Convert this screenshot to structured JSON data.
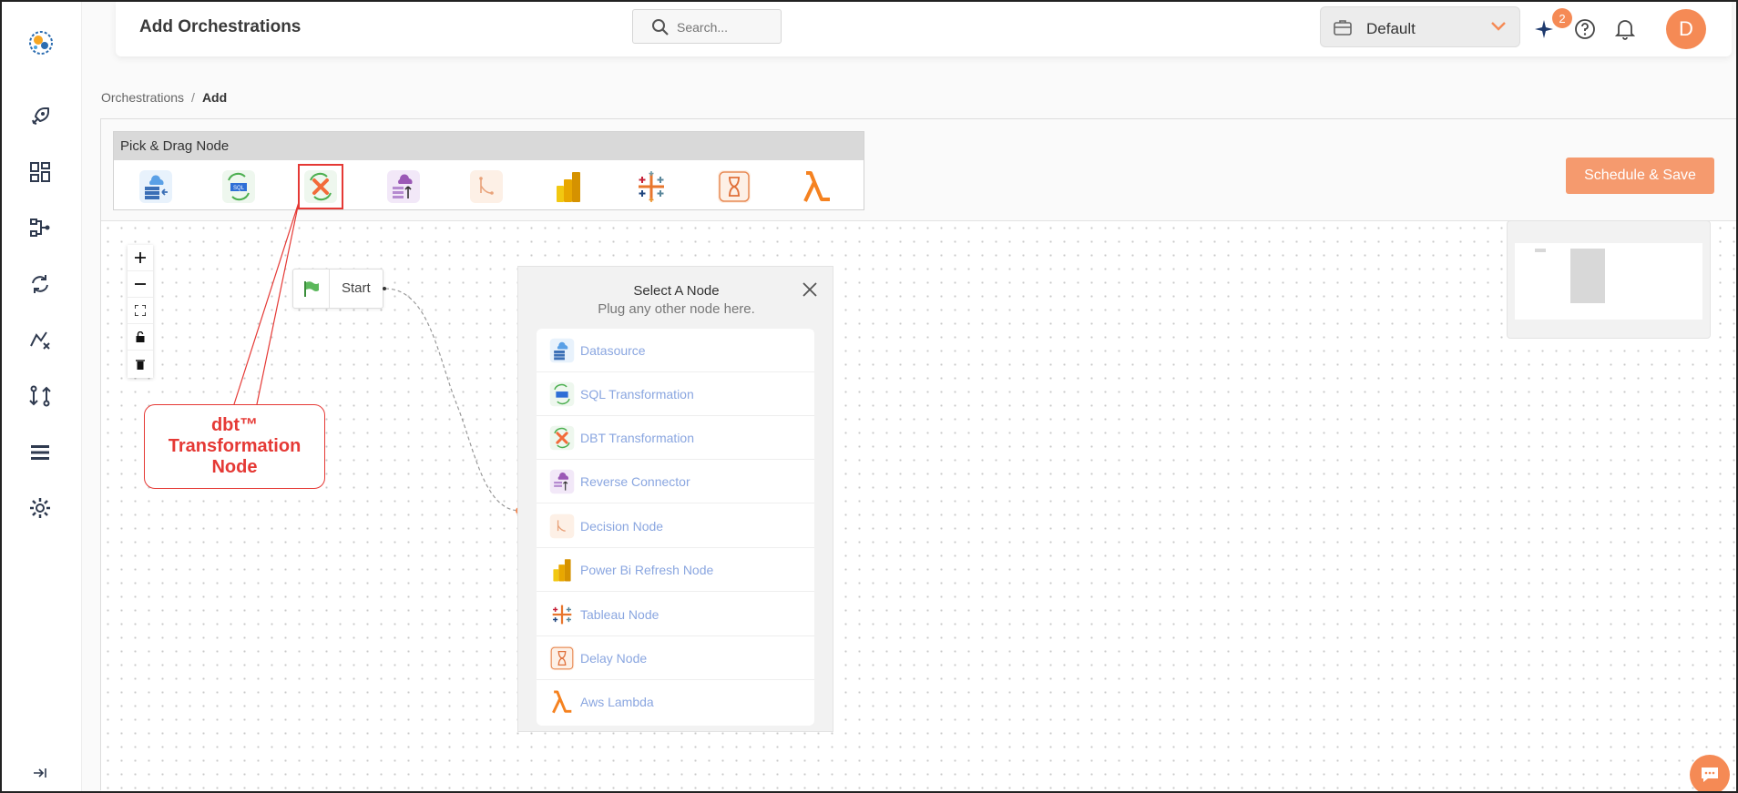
{
  "header": {
    "title": "Add Orchestrations",
    "search_placeholder": "Search...",
    "workspace": "Default",
    "notification_count": "2",
    "avatar_initial": "D"
  },
  "breadcrumb": {
    "parent": "Orchestrations",
    "separator": "/",
    "current": "Add"
  },
  "sidebar": {
    "items": [
      "rocket-icon",
      "dashboard-icon",
      "pipeline-icon",
      "sync-icon",
      "transform-icon",
      "compare-icon",
      "list-icon",
      "settings-icon"
    ]
  },
  "palette": {
    "title": "Pick & Drag Node",
    "items": [
      "Datasource",
      "SQL Transformation",
      "DBT Transformation",
      "Reverse Connector",
      "Decision Node",
      "Power Bi Refresh Node",
      "Tableau Node",
      "Delay Node",
      "Aws Lambda"
    ]
  },
  "toolbar": {
    "schedule_label": "Schedule & Save"
  },
  "canvas": {
    "start_label": "Start",
    "select_panel": {
      "title": "Select A Node",
      "subtitle": "Plug any other node here.",
      "items": [
        "Datasource",
        "SQL Transformation",
        "DBT Transformation",
        "Reverse Connector",
        "Decision Node",
        "Power Bi Refresh Node",
        "Tableau Node",
        "Delay Node",
        "Aws Lambda"
      ]
    }
  },
  "annotation": {
    "line1": "dbt™",
    "line2": "Transformation",
    "line3": "Node"
  },
  "colors": {
    "accent": "#f58a55",
    "callout": "#e53935",
    "link": "#8aa6e0"
  }
}
